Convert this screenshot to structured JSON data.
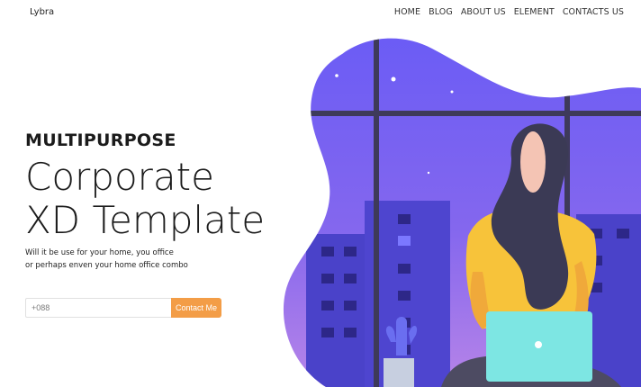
{
  "nav": {
    "brand": "Lybra",
    "items": [
      "HOME",
      "BLOG",
      "ABOUT US",
      "ELEMENT",
      "CONTACTS US"
    ]
  },
  "hero": {
    "eyebrow": "MULTIPURPOSE",
    "headline_line1": "Corporate",
    "headline_line2": "XD Template",
    "desc_line1": "Will it be use for your home, you office",
    "desc_line2": "or perhaps enven your home office combo"
  },
  "contact": {
    "placeholder": "+088",
    "button_label": "Contact Me"
  },
  "colors": {
    "accent": "#f39d47",
    "sky_top": "#6b5cf5",
    "sky_bottom": "#b07ce6",
    "building": "#4a42c9",
    "window_frame": "#3e3a5a",
    "laptop": "#7de6e3",
    "sweater": "#f7c33a",
    "hair": "#3b3a55"
  },
  "icons": {
    "laptop": "laptop-icon",
    "plant": "cactus-icon"
  }
}
